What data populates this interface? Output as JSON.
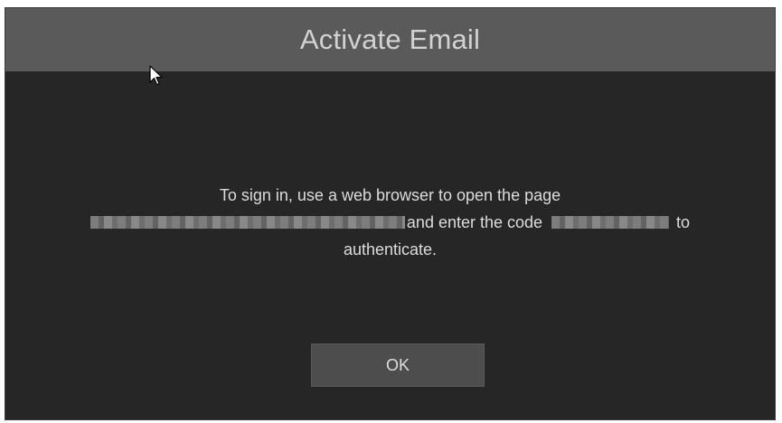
{
  "dialog": {
    "title": "Activate Email",
    "message": {
      "line1": "To sign in, use a web browser to open the page",
      "line2_middle": "and enter the code",
      "line2_end": "to",
      "line3": "authenticate."
    },
    "ok_label": "OK"
  },
  "icons": {
    "cursor": "mouse-pointer-icon"
  },
  "colors": {
    "dialog_background": "#262626",
    "title_bar": "#5a5a5a",
    "button": "#4d4d4d",
    "text": "#dcdcdc"
  }
}
